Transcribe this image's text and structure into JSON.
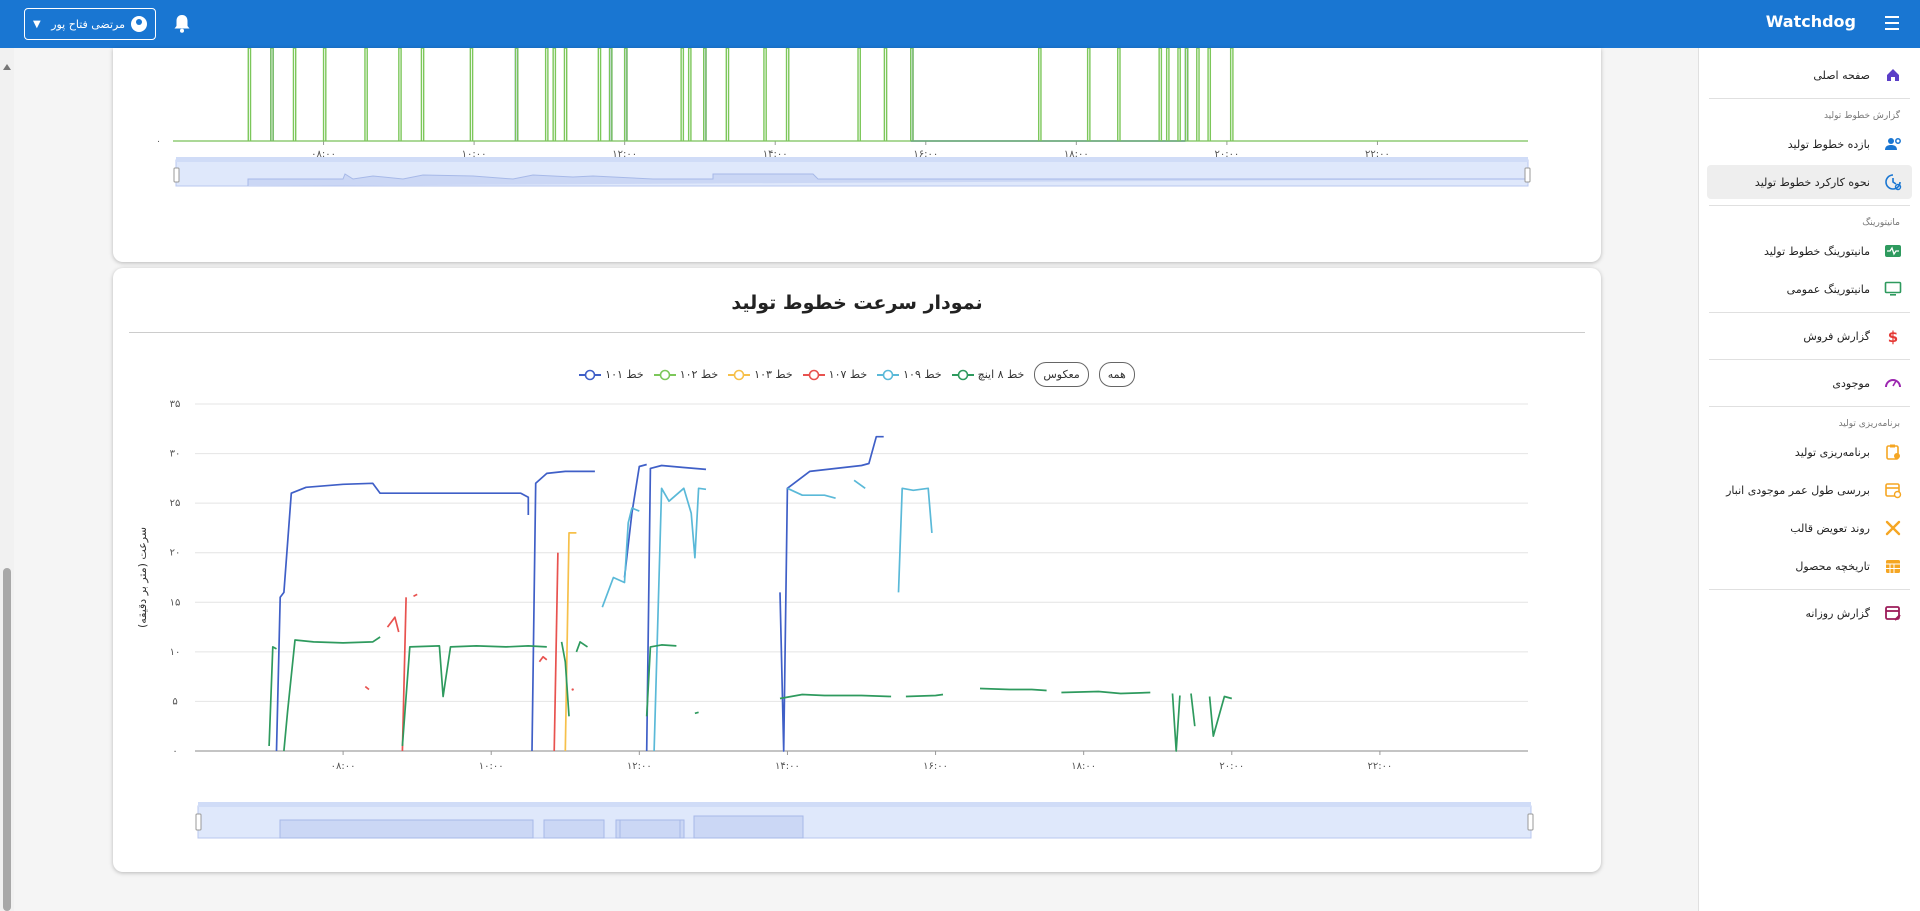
{
  "app": {
    "title": "Watchdog",
    "user_name": "مرتضی فتاح پور"
  },
  "sidebar": {
    "home": "صفحه اصلی",
    "group_report": "گزارش خطوط تولید",
    "efficiency": "بازده خطوط تولید",
    "performance": "نحوه کارکرد خطوط تولید",
    "group_monitor": "مانیتورینگ",
    "monitor_lines": "مانیتورینگ خطوط تولید",
    "monitor_general": "مانیتورینگ عمومی",
    "sales": "گزارش فروش",
    "inventory": "موجودی",
    "group_planning": "برنامه‌ریزی تولید",
    "planning": "برنامه‌ریزی تولید",
    "shelf_life": "بررسی طول عمر موجودی انبار",
    "mold_change": "روند تعویض قالب",
    "product_history": "تاریخچه محصول",
    "daily_report": "گزارش روزانه"
  },
  "colors": {
    "primary": "#1976d2",
    "l101": "#3f5fc7",
    "l102": "#7cc75a",
    "l103": "#f6c04a",
    "l107": "#e8524f",
    "l109": "#5ab9d8",
    "l8inch": "#2e9a5e"
  },
  "card2": {
    "title": "نمودار سرعت خطوط تولید",
    "btn_all": "همه",
    "btn_invert": "معکوس",
    "legend": [
      "خط ۸ اینچ",
      "خط ۱۰۹",
      "خط ۱۰۷",
      "خط ۱۰۳",
      "خط ۱۰۲",
      "خط ۱۰۱"
    ]
  },
  "chart_data": [
    {
      "type": "line",
      "title": "",
      "x_ticks": [
        "۰۸:۰۰",
        "۱۰:۰۰",
        "۱۲:۰۰",
        "۱۴:۰۰",
        "۱۶:۰۰",
        "۱۸:۰۰",
        "۲۰:۰۰",
        "۲۲:۰۰"
      ],
      "y_ticks": [
        "۰"
      ],
      "series": [
        {
          "name": "خط ۱۰۱",
          "color": "#3f5fc7",
          "spikes_at": [
            7.3,
            10.55,
            11.8,
            12.0,
            13.05,
            15.8,
            19.45
          ]
        },
        {
          "name": "خط ۱۰۲",
          "color": "#7cc75a",
          "spikes_at": [
            7.0,
            7.3,
            7.6,
            8.0,
            8.55,
            9.0,
            9.3,
            9.95,
            10.55,
            10.95,
            11.05,
            11.2,
            11.65,
            11.8,
            12.0,
            12.75,
            12.85,
            13.05,
            13.35,
            13.85,
            14.15,
            15.1,
            15.45,
            15.8,
            17.5,
            18.15,
            18.55,
            19.1,
            19.2,
            19.35,
            19.45,
            19.6,
            19.75,
            20.05
          ]
        }
      ],
      "baseline_segments": [
        {
          "series": "خط ۱۰۱",
          "from": 15.8,
          "to": 19.45
        }
      ]
    },
    {
      "type": "line",
      "title": "نمودار سرعت خطوط تولید",
      "ylabel": "سرعت (متر بر دقیقه)",
      "x_ticks": [
        "۰۸:۰۰",
        "۱۰:۰۰",
        "۱۲:۰۰",
        "۱۴:۰۰",
        "۱۶:۰۰",
        "۱۸:۰۰",
        "۲۰:۰۰",
        "۲۲:۰۰"
      ],
      "y_ticks": [
        "۰",
        "۵",
        "۱۰",
        "۱۵",
        "۲۰",
        "۲۵",
        "۳۰",
        "۳۵"
      ],
      "xlim": [
        6.0,
        24.0
      ],
      "ylim": [
        0,
        35
      ],
      "series": [
        {
          "name": "خط ۱۰۱",
          "color": "#3f5fc7",
          "segments": [
            [
              [
                7.1,
                0
              ],
              [
                7.15,
                15.5
              ],
              [
                7.2,
                16
              ],
              [
                7.3,
                26
              ],
              [
                7.5,
                26.6
              ],
              [
                8.0,
                26.9
              ],
              [
                8.4,
                27.0
              ],
              [
                8.5,
                26
              ],
              [
                9.0,
                26
              ],
              [
                10.0,
                26
              ],
              [
                10.4,
                26
              ],
              [
                10.5,
                25.6
              ],
              [
                10.5,
                23.8
              ]
            ],
            [
              [
                10.55,
                0
              ],
              [
                10.6,
                27
              ],
              [
                10.75,
                28
              ],
              [
                11.0,
                28.2
              ],
              [
                11.4,
                28.2
              ]
            ],
            [
              [
                11.8,
                17.5
              ],
              [
                11.9,
                24
              ],
              [
                12.0,
                28.7
              ],
              [
                12.1,
                28.9
              ]
            ],
            [
              [
                12.1,
                0
              ],
              [
                12.15,
                28.5
              ],
              [
                12.3,
                28.8
              ],
              [
                12.6,
                28.6
              ],
              [
                12.9,
                28.4
              ]
            ],
            [
              [
                13.9,
                16
              ],
              [
                13.95,
                0
              ],
              [
                14.0,
                26.5
              ],
              [
                14.3,
                28.2
              ],
              [
                15.0,
                28.8
              ],
              [
                15.1,
                29.0
              ],
              [
                15.2,
                31.7
              ],
              [
                15.3,
                31.7
              ]
            ]
          ]
        },
        {
          "name": "خط ۱۰۹",
          "color": "#5ab9d8",
          "segments": [
            [
              [
                11.5,
                14.5
              ],
              [
                11.65,
                17.5
              ],
              [
                11.8,
                17.0
              ],
              [
                11.85,
                23
              ],
              [
                11.9,
                24.5
              ],
              [
                12.0,
                24.2
              ]
            ],
            [
              [
                12.2,
                0
              ],
              [
                12.3,
                26.5
              ],
              [
                12.4,
                25.2
              ],
              [
                12.6,
                26.5
              ],
              [
                12.7,
                24
              ],
              [
                12.75,
                19.5
              ],
              [
                12.8,
                26.5
              ],
              [
                12.9,
                26.4
              ]
            ],
            [
              [
                14.0,
                26.5
              ],
              [
                14.2,
                25.8
              ],
              [
                14.5,
                25.8
              ],
              [
                14.65,
                25.5
              ]
            ],
            [
              [
                14.9,
                27.3
              ],
              [
                15.05,
                26.5
              ]
            ],
            [
              [
                15.5,
                16
              ],
              [
                15.55,
                26.5
              ],
              [
                15.7,
                26.3
              ],
              [
                15.9,
                26.5
              ],
              [
                15.95,
                22
              ]
            ]
          ]
        },
        {
          "name": "خط ۱۰۷",
          "color": "#e8524f",
          "segments": [
            [
              [
                8.3,
                6.5
              ],
              [
                8.35,
                6.2
              ]
            ],
            [
              [
                8.6,
                12.5
              ],
              [
                8.7,
                13.5
              ],
              [
                8.75,
                12.0
              ]
            ],
            [
              [
                8.8,
                0
              ],
              [
                8.85,
                15.5
              ]
            ],
            [
              [
                8.95,
                15.6
              ],
              [
                9.0,
                15.8
              ]
            ],
            [
              [
                10.65,
                9.0
              ],
              [
                10.7,
                9.5
              ],
              [
                10.75,
                9.2
              ]
            ],
            [
              [
                10.85,
                0
              ],
              [
                10.9,
                20
              ]
            ],
            [
              [
                11.1,
                6.2
              ]
            ]
          ]
        },
        {
          "name": "خط ۱۰۳",
          "color": "#f6c04a",
          "segments": [
            [
              [
                11.0,
                0
              ],
              [
                11.05,
                22
              ],
              [
                11.1,
                22
              ],
              [
                11.15,
                22
              ]
            ]
          ]
        },
        {
          "name": "خط ۸ اینچ",
          "color": "#2e9a5e",
          "segments": [
            [
              [
                7.0,
                0.5
              ],
              [
                7.05,
                10.5
              ],
              [
                7.1,
                10.3
              ]
            ],
            [
              [
                7.2,
                0
              ],
              [
                7.25,
                4
              ],
              [
                7.35,
                11.2
              ],
              [
                7.6,
                11.0
              ],
              [
                8.0,
                10.9
              ],
              [
                8.4,
                11.0
              ],
              [
                8.5,
                11.5
              ]
            ],
            [
              [
                8.8,
                0.5
              ],
              [
                8.9,
                10.5
              ],
              [
                9.3,
                10.6
              ],
              [
                9.35,
                5.5
              ],
              [
                9.45,
                10.5
              ],
              [
                9.8,
                10.6
              ],
              [
                10.2,
                10.5
              ],
              [
                10.5,
                10.6
              ],
              [
                10.75,
                10.5
              ]
            ],
            [
              [
                10.95,
                11
              ],
              [
                11.0,
                9.0
              ],
              [
                11.05,
                3.5
              ]
            ],
            [
              [
                11.15,
                10
              ],
              [
                11.2,
                11
              ],
              [
                11.3,
                10.5
              ]
            ],
            [
              [
                12.1,
                3.5
              ],
              [
                12.15,
                10.5
              ],
              [
                12.3,
                10.7
              ],
              [
                12.5,
                10.6
              ]
            ],
            [
              [
                12.75,
                3.8
              ],
              [
                12.8,
                3.9
              ]
            ],
            [
              [
                13.9,
                5.3
              ],
              [
                14.2,
                5.7
              ],
              [
                14.5,
                5.6
              ],
              [
                15.0,
                5.6
              ],
              [
                15.4,
                5.5
              ]
            ],
            [
              [
                15.6,
                5.5
              ],
              [
                16.0,
                5.6
              ],
              [
                16.1,
                5.7
              ]
            ],
            [
              [
                16.6,
                6.3
              ],
              [
                17.0,
                6.2
              ],
              [
                17.3,
                6.2
              ],
              [
                17.5,
                6.1
              ]
            ],
            [
              [
                17.7,
                5.9
              ],
              [
                18.2,
                6.0
              ],
              [
                18.5,
                5.8
              ],
              [
                18.9,
                5.9
              ]
            ],
            [
              [
                19.2,
                5.8
              ],
              [
                19.25,
                0
              ],
              [
                19.3,
                5.6
              ]
            ],
            [
              [
                19.45,
                5.8
              ],
              [
                19.5,
                2.5
              ]
            ],
            [
              [
                19.7,
                5.5
              ],
              [
                19.75,
                1.5
              ],
              [
                19.9,
                5.5
              ],
              [
                20.0,
                5.3
              ]
            ]
          ]
        },
        {
          "name": "خط ۱۰۲",
          "color": "#7cc75a",
          "segments": []
        }
      ]
    }
  ]
}
